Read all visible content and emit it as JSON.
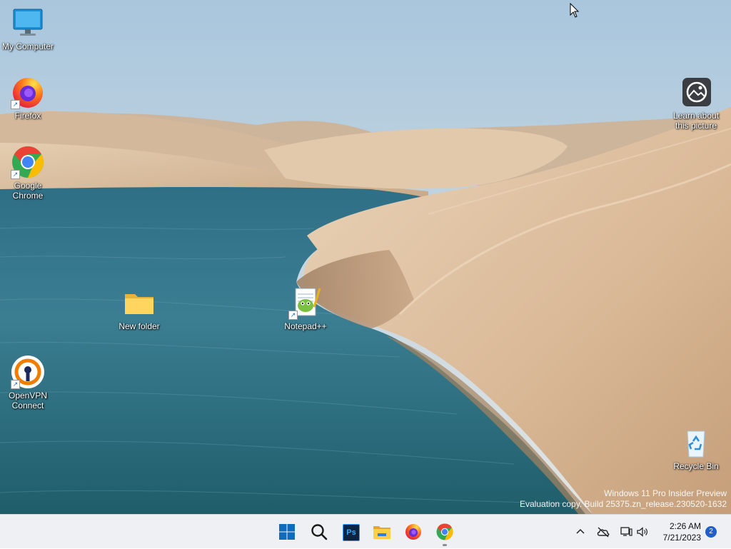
{
  "desktop": {
    "icons": {
      "my_computer": {
        "label": "My Computer",
        "icon": "monitor-icon"
      },
      "firefox": {
        "label": "Firefox",
        "icon": "firefox-icon"
      },
      "chrome": {
        "label": "Google Chrome",
        "icon": "chrome-icon"
      },
      "openvpn": {
        "label": "OpenVPN Connect",
        "icon": "openvpn-icon"
      },
      "new_folder": {
        "label": "New folder",
        "icon": "folder-icon"
      },
      "notepadpp": {
        "label": "Notepad++",
        "icon": "notepadpp-icon"
      },
      "learn_picture": {
        "label": "Learn about this picture",
        "icon": "image-info-icon"
      },
      "recycle_bin": {
        "label": "Recycle Bin",
        "icon": "recycle-bin-icon"
      }
    },
    "watermark": {
      "line1": "Windows 11 Pro Insider Preview",
      "line2": "Evaluation copy. Build 25375.zn_release.230520-1632"
    }
  },
  "taskbar": {
    "apps": [
      "start-icon",
      "search-icon",
      "photoshop-icon",
      "file-explorer-icon",
      "firefox-icon",
      "chrome-icon"
    ],
    "photoshop_label": "Ps",
    "tray": {
      "time": "2:26 AM",
      "date": "7/21/2023",
      "notification_count": "2"
    }
  },
  "colors": {
    "taskbar_bg": "#eef0f3",
    "accent": "#1f5fc7",
    "windows_blue": "#0f6cbd"
  }
}
